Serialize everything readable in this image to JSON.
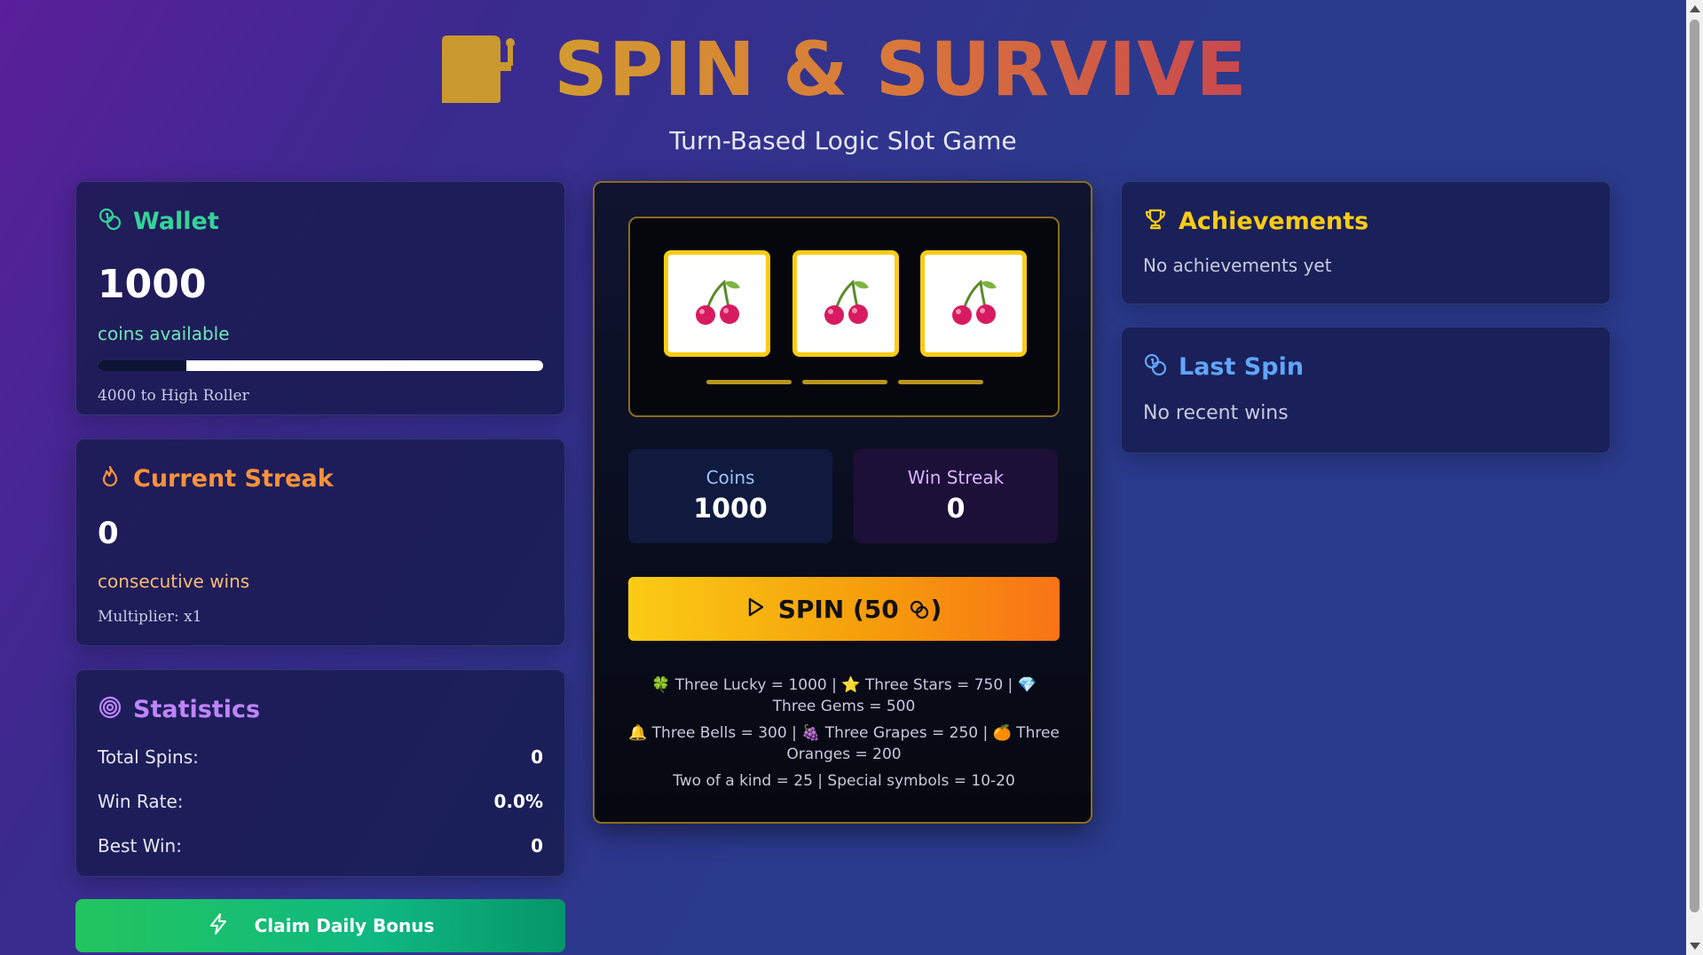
{
  "header": {
    "title": "SPIN & SURVIVE",
    "subtitle": "Turn-Based Logic Slot Game"
  },
  "wallet": {
    "title": "Wallet",
    "amount": "1000",
    "caption": "coins available",
    "progress_fraction": 0.2,
    "progress_note": "4000 to High Roller"
  },
  "streak": {
    "title": "Current Streak",
    "value": "0",
    "caption": "consecutive wins",
    "multiplier": "Multiplier: x1"
  },
  "stats": {
    "title": "Statistics",
    "rows": [
      {
        "label": "Total Spins:",
        "value": "0"
      },
      {
        "label": "Win Rate:",
        "value": "0.0%"
      },
      {
        "label": "Best Win:",
        "value": "0"
      }
    ]
  },
  "bonus_button": "Claim Daily Bonus",
  "machine": {
    "reels": [
      "cherries-icon",
      "cherries-icon",
      "cherries-icon"
    ],
    "coins_label": "Coins",
    "coins_value": "1000",
    "streak_label": "Win Streak",
    "streak_value": "0",
    "spin_label": "SPIN (50",
    "spin_suffix": ")",
    "paytable": {
      "line1": "Three Lucky = 1000 | ⭐ Three Stars = 750 | 💎 Three Gems = 500",
      "line2": "Three Bells = 300 | 🍇 Three Grapes = 250 | 🍊 Three Oranges = 200",
      "line3": "Two of a kind = 25 | Special symbols = 10-20"
    }
  },
  "achievements": {
    "title": "Achievements",
    "empty": "No achievements yet"
  },
  "last_spin": {
    "title": "Last Spin",
    "empty": "No recent wins"
  },
  "colors": {
    "wallet": "#34d399",
    "streak": "#fb923c",
    "stats": "#c084fc",
    "achievements": "#facc15",
    "last_spin": "#60a5fa",
    "spin_button": "#f59e0b",
    "bonus_button": "#10b981"
  }
}
